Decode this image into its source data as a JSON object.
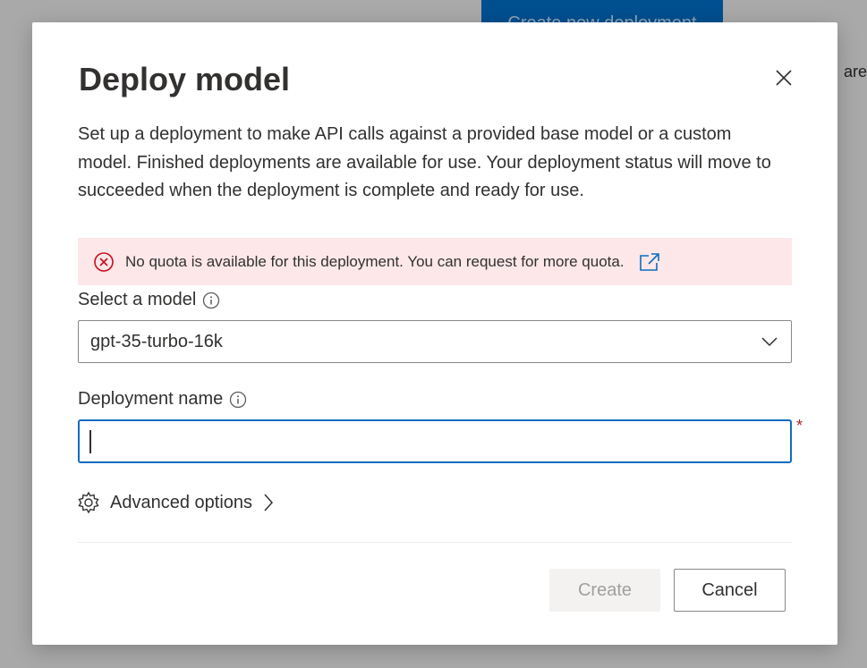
{
  "background": {
    "primary_button_label": "Create new deployment",
    "text_fragment": "are"
  },
  "dialog": {
    "title": "Deploy model",
    "close_icon": "close-icon",
    "description": "Set up a deployment to make API calls against a provided base model or a custom model. Finished deployments are available for use. Your deployment status will move to succeeded when the deployment is complete and ready for use.",
    "error": {
      "icon": "error-circle-icon",
      "message": "No quota is available for this deployment. You can request for more quota.",
      "link_icon": "external-link-icon"
    },
    "model_field": {
      "label": "Select a model",
      "value": "gpt-35-turbo-16k"
    },
    "deployment_name_field": {
      "label": "Deployment name",
      "value": "",
      "required_marker": "*"
    },
    "advanced_options_label": "Advanced options",
    "buttons": {
      "create_label": "Create",
      "cancel_label": "Cancel"
    }
  },
  "colors": {
    "accent": "#0f6cbd",
    "error_bg": "#fde7e9",
    "error_icon": "#c50f1f",
    "link": "#0f6cbd",
    "required": "#a4262c",
    "overlay": "#a9a9a9"
  }
}
